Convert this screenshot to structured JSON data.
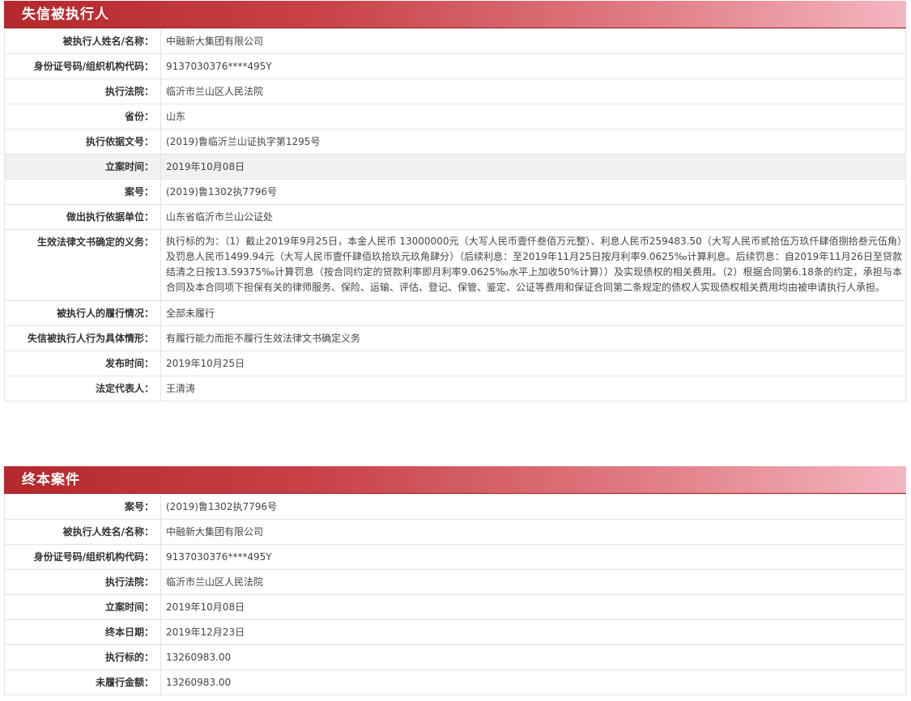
{
  "sections": [
    {
      "title": "失信被执行人",
      "rows": [
        {
          "label": "被执行人姓名/名称：",
          "value": "中融新大集团有限公司"
        },
        {
          "label": "身份证号码/组织机构代码：",
          "value": "9137030376****495Y"
        },
        {
          "label": "执行法院：",
          "value": "临沂市兰山区人民法院"
        },
        {
          "label": "省份：",
          "value": "山东"
        },
        {
          "label": "执行依据文号：",
          "value": "(2019)鲁临沂兰山证执字第1295号"
        },
        {
          "label": "立案时间：",
          "value": "2019年10月08日",
          "highlighted": true
        },
        {
          "label": "案号：",
          "value": "(2019)鲁1302执7796号"
        },
        {
          "label": "做出执行依据单位：",
          "value": "山东省临沂市兰山公证处"
        },
        {
          "label": "生效法律文书确定的义务：",
          "value": "执行标的为：（1）截止2019年9月25日，本金人民币 13000000元（大写人民币壹仟叁佰万元整）、利息人民币259483.50（大写人民币贰拾伍万玖仟肆佰捌拾叁元伍角）及罚息人民币1499.94元（大写人民币壹仟肆佰玖拾玖元玖角肆分）（后续利息：至2019年11月25日按月利率9.0625‰计算利息。后续罚息：自2019年11月26日至贷款结清之日按13.59375‰计算罚息（按合同约定的贷款利率即月利率9.0625‰水平上加收50%计算））及实现债权的相关费用。（2）根据合同第6.18条的约定，承担与本合同及本合同项下担保有关的律师服务、保险、运输、评估、登记、保管、鉴定、公证等费用和保证合同第二条规定的债权人实现债权相关费用均由被申请执行人承担。",
          "long": true
        },
        {
          "label": "被执行人的履行情况：",
          "value": "全部未履行"
        },
        {
          "label": "失信被执行人行为具体情形：",
          "value": "有履行能力而拒不履行生效法律文书确定义务"
        },
        {
          "label": "发布时间：",
          "value": "2019年10月25日"
        },
        {
          "label": "法定代表人：",
          "value": "王清涛"
        }
      ]
    },
    {
      "title": "终本案件",
      "rows": [
        {
          "label": "案号：",
          "value": "(2019)鲁1302执7796号"
        },
        {
          "label": "被执行人姓名/名称：",
          "value": "中融新大集团有限公司"
        },
        {
          "label": "身份证号码/组织机构代码：",
          "value": "9137030376****495Y"
        },
        {
          "label": "执行法院：",
          "value": "临沂市兰山区人民法院"
        },
        {
          "label": "立案时间：",
          "value": "2019年10月08日"
        },
        {
          "label": "终本日期：",
          "value": "2019年12月23日"
        },
        {
          "label": "执行标的：",
          "value": "13260983.00"
        },
        {
          "label": "未履行金额：",
          "value": "13260983.00"
        }
      ]
    }
  ]
}
